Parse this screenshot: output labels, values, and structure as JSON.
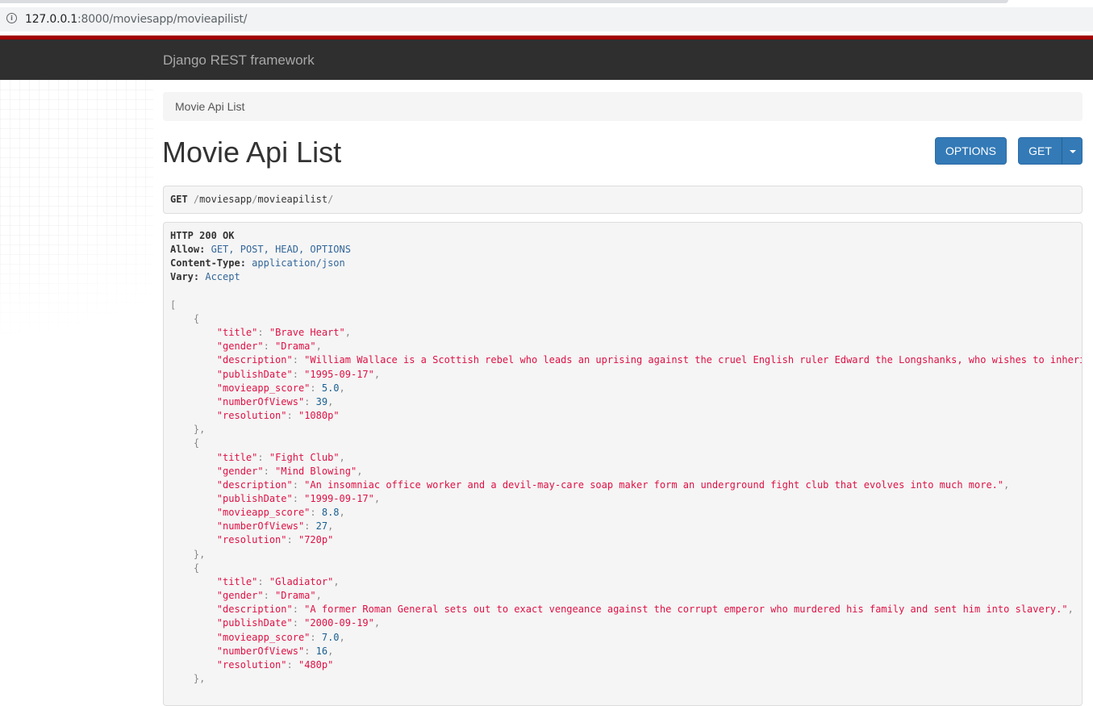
{
  "browser": {
    "url_host": "127.0.0.1",
    "url_rest": ":8000/moviesapp/movieapilist/",
    "info_icon": "info-icon"
  },
  "navbar": {
    "brand": "Django REST framework"
  },
  "breadcrumb": {
    "item": "Movie Api List"
  },
  "page": {
    "title": "Movie Api List"
  },
  "buttons": {
    "options": "OPTIONS",
    "get": "GET",
    "caret_icon": "caret-down-icon"
  },
  "request": {
    "method": "GET",
    "path_parts": [
      "moviesapp",
      "movieapilist"
    ]
  },
  "response": {
    "status": "HTTP 200 OK",
    "headers": [
      {
        "name": "Allow:",
        "value": "GET, POST, HEAD, OPTIONS"
      },
      {
        "name": "Content-Type:",
        "value": "application/json"
      },
      {
        "name": "Vary:",
        "value": "Accept"
      }
    ],
    "movies": [
      {
        "title": "Brave Heart",
        "gender": "Drama",
        "description": "William Wallace is a Scottish rebel who leads an uprising against the cruel English ruler Edward the Longshanks, who wishes to inheri",
        "publishDate": "1995-09-17",
        "movieapp_score": "5.0",
        "numberOfViews": "39",
        "resolution": "1080p"
      },
      {
        "title": "Fight Club",
        "gender": "Mind Blowing",
        "description": "An insomniac office worker and a devil-may-care soap maker form an underground fight club that evolves into much more.",
        "publishDate": "1999-09-17",
        "movieapp_score": "8.8",
        "numberOfViews": "27",
        "resolution": "720p"
      },
      {
        "title": "Gladiator",
        "gender": "Drama",
        "description": "A former Roman General sets out to exact vengeance against the corrupt emperor who murdered his family and sent him into slavery.",
        "publishDate": "2000-09-19",
        "movieapp_score": "7.0",
        "numberOfViews": "16",
        "resolution": "480p"
      }
    ]
  }
}
